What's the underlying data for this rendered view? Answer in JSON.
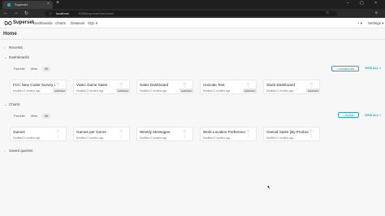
{
  "browser": {
    "tab_title": "Superset",
    "tab_close": "×",
    "new_tab": "+",
    "window_controls": "– ▢ ×",
    "back": "←",
    "forward": "→",
    "reload": "↻",
    "url_host": "localhost",
    "url_path": ":8088/superset/welcome/",
    "star": "☆",
    "menu": "≡"
  },
  "app": {
    "brand": "Superset",
    "menu": [
      "Dashboards",
      "Charts",
      "Datasets",
      "SQL ▾"
    ],
    "plus": "+ ▾",
    "settings": "Settings ▾"
  },
  "page": {
    "title": "Home",
    "sections": {
      "recents": "Recents",
      "dashboards": "Dashboards",
      "charts": "Charts",
      "saved_queries": "Saved queries"
    },
    "filter_tabs": [
      "Favorite",
      "Mine",
      "All"
    ],
    "add_dashboard": "+ DASHBOARD",
    "add_chart": "+ CHART",
    "view_all": "VIEW ALL »"
  },
  "dashboards": [
    {
      "title": "FCC New Coder Survey 2...",
      "modified": "Modified 2 months ago",
      "badge": "published"
    },
    {
      "title": "Video Game Sales",
      "modified": "Modified 2 months ago",
      "badge": "published"
    },
    {
      "title": "Sales Dashboard",
      "modified": "Modified 2 months ago",
      "badge": "published"
    },
    {
      "title": "Unicode Test",
      "modified": "Modified 2 months ago",
      "badge": "published"
    },
    {
      "title": "Slack Dashboard",
      "modified": "Modified 2 months ago",
      "badge": "published"
    }
  ],
  "charts": [
    {
      "title": "Games",
      "modified": "Modified 2 months ago"
    },
    {
      "title": "Games per Genre",
      "modified": "Modified 2 months ago"
    },
    {
      "title": "Weekly Messages",
      "modified": "Modified 2 months ago"
    },
    {
      "title": "Work Location Preference",
      "modified": "Modified 2 months ago"
    },
    {
      "title": "Overall Sales (By Product ...",
      "modified": "Modified 2 months ago"
    }
  ],
  "card_icons": "☆ ⋮",
  "colors": {
    "accent": "#20a7c9",
    "brand_dark": "#484848"
  }
}
